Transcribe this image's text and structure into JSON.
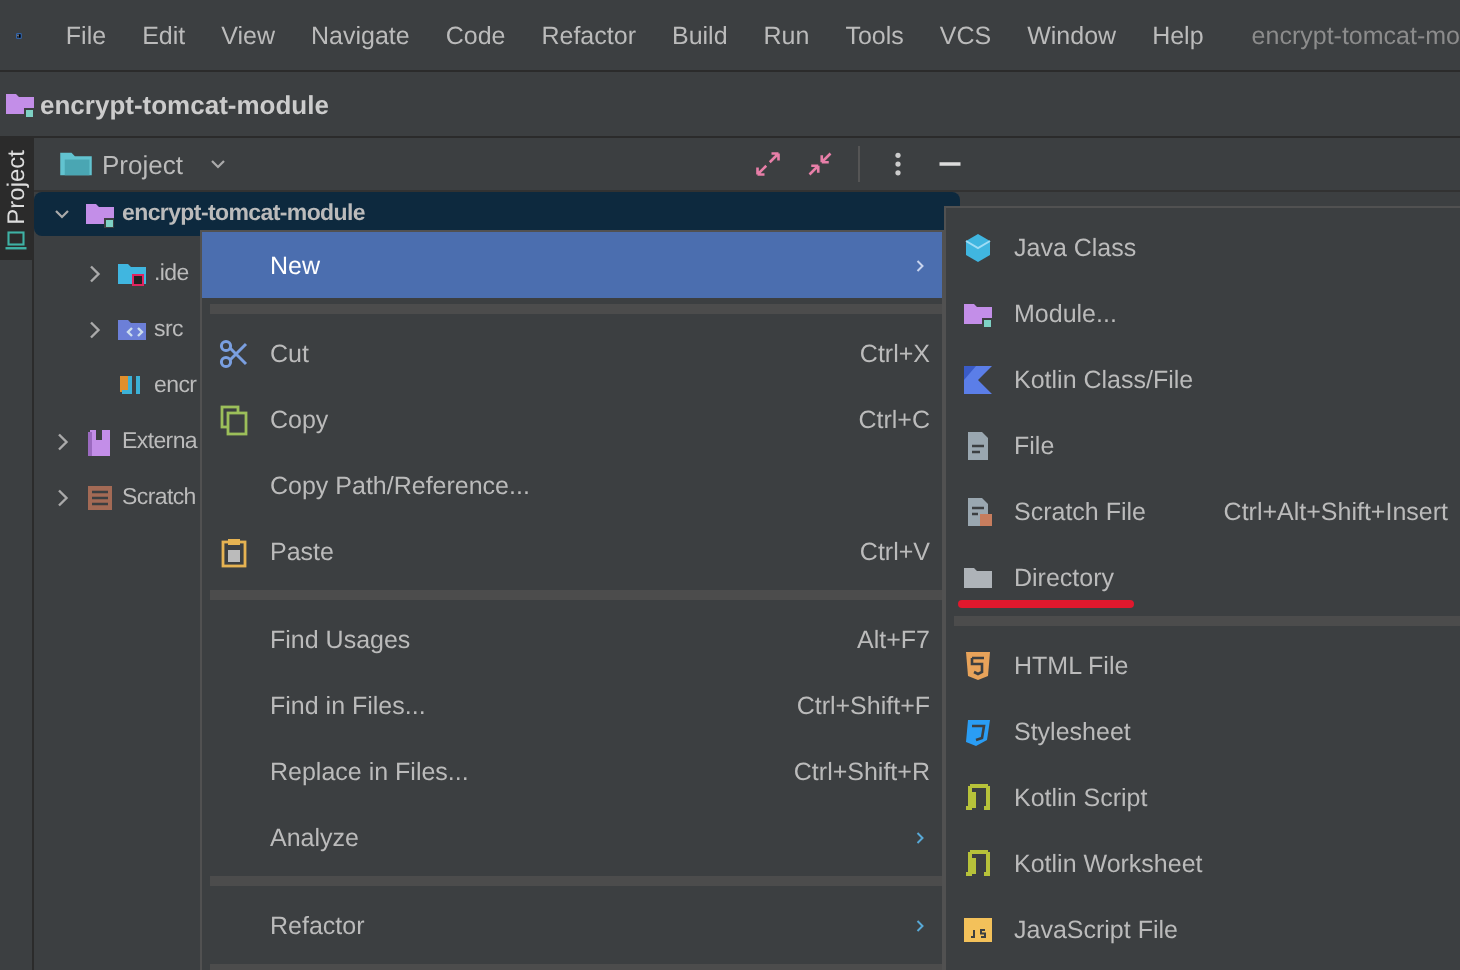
{
  "menu_bar": {
    "items": [
      "File",
      "Edit",
      "View",
      "Navigate",
      "Code",
      "Refactor",
      "Build",
      "Run",
      "Tools",
      "VCS",
      "Window",
      "Help"
    ],
    "title": "encrypt-tomcat-mo"
  },
  "nav_bar": {
    "project": "encrypt-tomcat-module"
  },
  "side_strip": {
    "tab": "Project",
    "selected": true
  },
  "project_panel": {
    "title": "Project",
    "tree": [
      {
        "label": "encrypt-tomcat-module",
        "expanded": true,
        "selected": true,
        "children": [
          {
            "label": ".ide",
            "expanded": false,
            "selected": false
          },
          {
            "label": "src",
            "expanded": false,
            "selected": false
          },
          {
            "label": "encr",
            "selected": false
          }
        ]
      },
      {
        "label": "Externa",
        "expanded": false,
        "selected": false
      },
      {
        "label": "Scratch",
        "expanded": false,
        "selected": false
      }
    ]
  },
  "context_menu": {
    "items": [
      {
        "kind": "item",
        "label": "New",
        "submenu": true,
        "selected": true
      },
      {
        "kind": "separator"
      },
      {
        "kind": "item",
        "label": "Cut",
        "shortcut": "Ctrl+X",
        "submenu": false,
        "selected": false
      },
      {
        "kind": "item",
        "label": "Copy",
        "shortcut": "Ctrl+C",
        "submenu": false,
        "selected": false
      },
      {
        "kind": "item",
        "label": "Copy Path/Reference...",
        "submenu": false,
        "selected": false
      },
      {
        "kind": "item",
        "label": "Paste",
        "shortcut": "Ctrl+V",
        "submenu": false,
        "selected": false
      },
      {
        "kind": "separator"
      },
      {
        "kind": "item",
        "label": "Find Usages",
        "shortcut": "Alt+F7",
        "submenu": false,
        "selected": false
      },
      {
        "kind": "item",
        "label": "Find in Files...",
        "shortcut": "Ctrl+Shift+F",
        "submenu": false,
        "selected": false
      },
      {
        "kind": "item",
        "label": "Replace in Files...",
        "shortcut": "Ctrl+Shift+R",
        "submenu": false,
        "selected": false
      },
      {
        "kind": "item",
        "label": "Analyze",
        "submenu": true,
        "selected": false
      },
      {
        "kind": "separator"
      },
      {
        "kind": "item",
        "label": "Refactor",
        "submenu": true,
        "selected": false
      },
      {
        "kind": "separator"
      }
    ]
  },
  "submenu": {
    "items": [
      {
        "kind": "item",
        "label": "Java Class",
        "annotated": false
      },
      {
        "kind": "item",
        "label": "Module...",
        "annotated": false
      },
      {
        "kind": "item",
        "label": "Kotlin Class/File",
        "annotated": false
      },
      {
        "kind": "item",
        "label": "File",
        "annotated": false
      },
      {
        "kind": "item",
        "label": "Scratch File",
        "shortcut": "Ctrl+Alt+Shift+Insert",
        "annotated": false
      },
      {
        "kind": "item",
        "label": "Directory",
        "annotated": true
      },
      {
        "kind": "separator"
      },
      {
        "kind": "item",
        "label": "HTML File",
        "annotated": false
      },
      {
        "kind": "item",
        "label": "Stylesheet",
        "annotated": false
      },
      {
        "kind": "item",
        "label": "Kotlin Script",
        "annotated": false
      },
      {
        "kind": "item",
        "label": "Kotlin Worksheet",
        "annotated": false
      },
      {
        "kind": "item",
        "label": "JavaScript File",
        "annotated": false
      }
    ]
  }
}
